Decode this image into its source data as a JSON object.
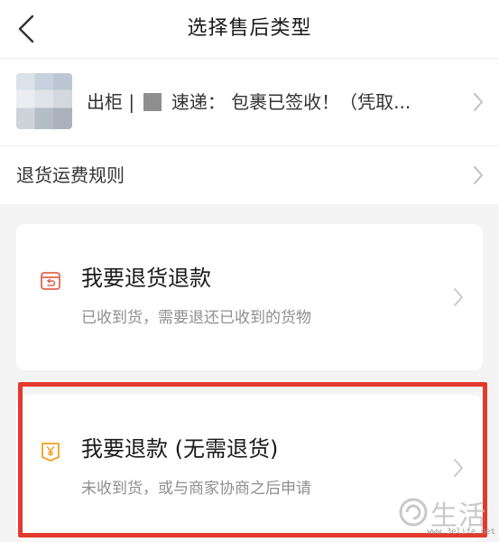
{
  "nav": {
    "title": "选择售后类型",
    "back_icon": "chevron-left-icon"
  },
  "order": {
    "prefix": "出柜 |",
    "text": "速递： 包裹已签收！（凭取...",
    "thumbnail_icon": "product-thumbnail",
    "arrow_icon": "chevron-right-icon"
  },
  "rules": {
    "label": "退货运费规则",
    "arrow_icon": "chevron-right-icon"
  },
  "options": [
    {
      "title": "我要退货退款",
      "subtitle": "已收到货，需要退还已收到的货物",
      "icon": "return-package-icon",
      "icon_color": "#e0664f"
    },
    {
      "title": "我要退款 (无需退货)",
      "subtitle": "未收到货，或与商家协商之后申请",
      "icon": "yen-refund-icon",
      "icon_color": "#f0a020"
    }
  ],
  "highlight_color": "#e23a2d",
  "watermark": {
    "text": "生活",
    "url": "www.3elife.net"
  }
}
